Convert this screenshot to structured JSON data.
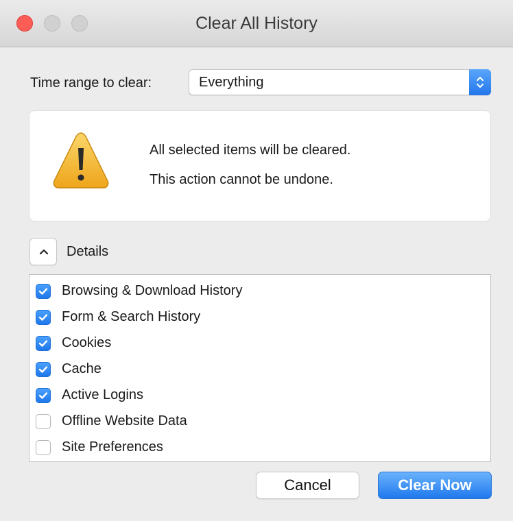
{
  "window": {
    "title": "Clear All History"
  },
  "time_range": {
    "label": "Time range to clear:",
    "selected": "Everything"
  },
  "warning": {
    "line1": "All selected items will be cleared.",
    "line2": "This action cannot be undone."
  },
  "details": {
    "label": "Details",
    "expanded": true
  },
  "items": [
    {
      "label": "Browsing & Download History",
      "checked": true
    },
    {
      "label": "Form & Search History",
      "checked": true
    },
    {
      "label": "Cookies",
      "checked": true
    },
    {
      "label": "Cache",
      "checked": true
    },
    {
      "label": "Active Logins",
      "checked": true
    },
    {
      "label": "Offline Website Data",
      "checked": false
    },
    {
      "label": "Site Preferences",
      "checked": false
    }
  ],
  "buttons": {
    "cancel": "Cancel",
    "clear_now": "Clear Now"
  },
  "colors": {
    "accent": "#2376ea",
    "close_button": "#fc5d57",
    "warning_icon": "#f5b72a"
  },
  "icons": {
    "select_stepper": "up-down-chevron-icon",
    "warning": "warning-triangle-icon",
    "details_toggle": "chevron-up-icon",
    "checkbox": "checkmark-icon"
  }
}
